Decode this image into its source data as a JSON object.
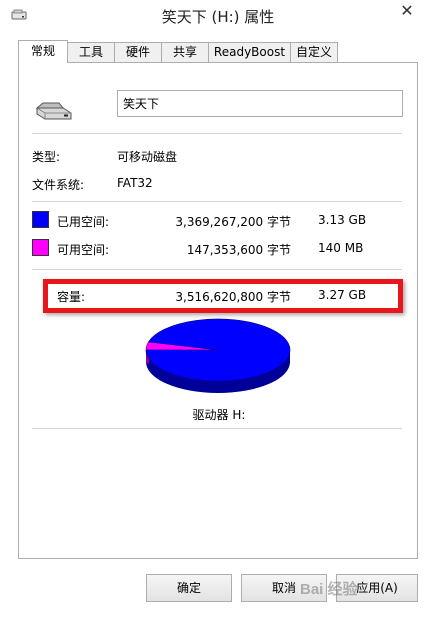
{
  "window": {
    "title": "笑天下 (H:) 属性",
    "close_glyph": "✕"
  },
  "tabs": [
    {
      "label": "常规",
      "active": true
    },
    {
      "label": "工具"
    },
    {
      "label": "硬件"
    },
    {
      "label": "共享"
    },
    {
      "label": "ReadyBoost"
    },
    {
      "label": "自定义"
    }
  ],
  "general": {
    "drive_name": "笑天下",
    "type_label": "类型:",
    "type_value": "可移动磁盘",
    "fs_label": "文件系统:",
    "fs_value": "FAT32",
    "used_label": "已用空间:",
    "used_bytes": "3,369,267,200 字节",
    "used_size": "3.13 GB",
    "used_color": "#0000ff",
    "free_label": "可用空间:",
    "free_bytes": "147,353,600 字节",
    "free_size": "140 MB",
    "free_color": "#ff00ff",
    "capacity_label": "容量:",
    "capacity_bytes": "3,516,620,800 字节",
    "capacity_size": "3.27 GB",
    "drive_label": "驱动器 H:",
    "highlight_color": "#e8161a"
  },
  "chart_data": {
    "type": "pie",
    "values": [
      3369267200,
      147353600
    ],
    "colors": [
      "#0000ff",
      "#ff00ff"
    ]
  },
  "buttons": {
    "ok": "确定",
    "cancel": "取消",
    "apply": "应用(A)"
  },
  "watermark": "Bai  经验"
}
